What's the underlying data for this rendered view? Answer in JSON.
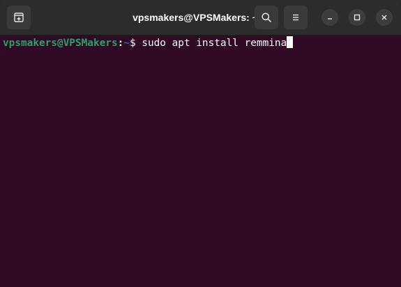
{
  "window": {
    "title": "vpsmakers@VPSMakers: ~"
  },
  "titlebar": {
    "new_tab_icon": "new-tab-icon",
    "search_icon": "search-icon",
    "menu_icon": "hamburger-menu-icon",
    "minimize_icon": "minimize-icon",
    "maximize_icon": "maximize-icon",
    "close_icon": "close-icon"
  },
  "terminal": {
    "prompt_user": "vpsmakers@VPSMakers",
    "prompt_sep": ":",
    "prompt_path": "~",
    "prompt_symbol": "$ ",
    "command": "sudo apt install remmina"
  },
  "colors": {
    "background": "#300a24",
    "titlebar": "#2c2c2c",
    "prompt_user": "#26a269",
    "prompt_path": "#3465a4"
  }
}
